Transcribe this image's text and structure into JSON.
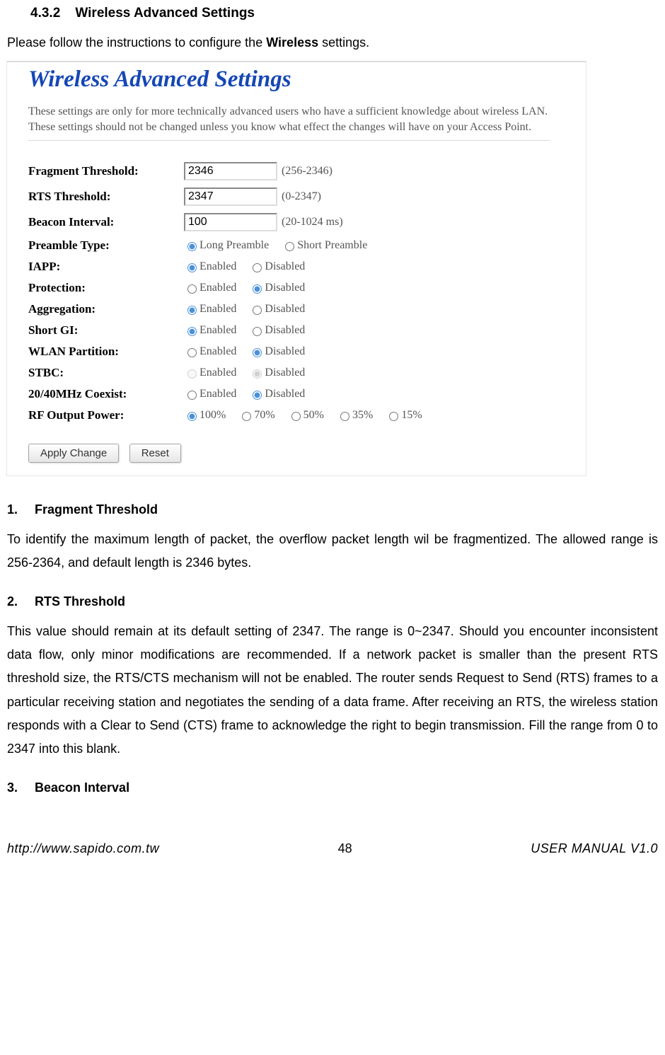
{
  "section_number": "4.3.2",
  "section_title": "Wireless Advanced Settings",
  "intro_prefix": "Please follow the instructions to configure the ",
  "intro_bold": "Wireless",
  "intro_suffix": " settings.",
  "screenshot": {
    "title": "Wireless Advanced Settings",
    "description": "These settings are only for more technically advanced users who have a sufficient knowledge about wireless LAN. These settings should not be changed unless you know what effect the changes will have on your Access Point.",
    "fields": {
      "fragment": {
        "label": "Fragment Threshold:",
        "value": "2346",
        "range": "(256-2346)"
      },
      "rts": {
        "label": "RTS Threshold:",
        "value": "2347",
        "range": "(0-2347)"
      },
      "beacon": {
        "label": "Beacon Interval:",
        "value": "100",
        "range": "(20-1024 ms)"
      },
      "preamble": {
        "label": "Preamble Type:",
        "options": [
          "Long Preamble",
          "Short Preamble"
        ],
        "selected": "Long Preamble"
      },
      "iapp": {
        "label": "IAPP:",
        "options": [
          "Enabled",
          "Disabled"
        ],
        "selected": "Enabled"
      },
      "protection": {
        "label": "Protection:",
        "options": [
          "Enabled",
          "Disabled"
        ],
        "selected": "Disabled"
      },
      "aggregation": {
        "label": "Aggregation:",
        "options": [
          "Enabled",
          "Disabled"
        ],
        "selected": "Enabled"
      },
      "shortgi": {
        "label": "Short GI:",
        "options": [
          "Enabled",
          "Disabled"
        ],
        "selected": "Enabled"
      },
      "wlanpart": {
        "label": "WLAN Partition:",
        "options": [
          "Enabled",
          "Disabled"
        ],
        "selected": "Disabled"
      },
      "stbc": {
        "label": "STBC:",
        "options": [
          "Enabled",
          "Disabled"
        ],
        "selected": "Disabled",
        "disabled": true
      },
      "coexist": {
        "label": "20/40MHz Coexist:",
        "options": [
          "Enabled",
          "Disabled"
        ],
        "selected": "Disabled"
      },
      "rfpower": {
        "label": "RF Output Power:",
        "options": [
          "100%",
          "70%",
          "50%",
          "35%",
          "15%"
        ],
        "selected": "100%"
      }
    },
    "buttons": {
      "apply": "Apply Change",
      "reset": "Reset"
    }
  },
  "content": {
    "h1_num": "1.",
    "h1": "Fragment Threshold",
    "p1": "To identify the maximum length of packet, the overflow packet length wil be fragmentized. The allowed range is 256-2364, and default length is 2346 bytes.",
    "h2_num": "2.",
    "h2": "RTS Threshold",
    "p2": "This value should remain at its default setting of 2347. The range is 0~2347. Should you encounter inconsistent data flow, only minor modifications are recommended. If a network packet is smaller than the present RTS threshold size, the RTS/CTS mechanism will not be enabled. The router sends Request to Send (RTS) frames to a particular receiving station and negotiates the sending of a data frame. After receiving an RTS, the wireless station responds with a Clear to Send (CTS) frame to acknowledge the right to begin transmission. Fill the range from 0 to 2347 into this blank.",
    "h3_num": "3.",
    "h3": "Beacon Interval"
  },
  "footer": {
    "left": "http://www.sapido.com.tw",
    "center": "48",
    "right": "USER MANUAL V1.0"
  }
}
